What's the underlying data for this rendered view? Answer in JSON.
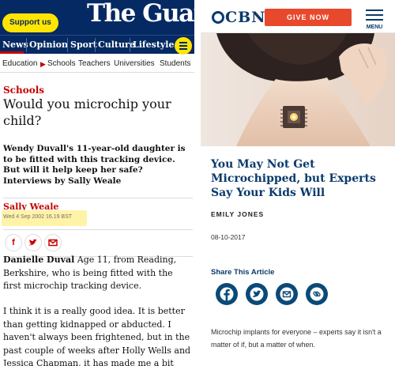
{
  "guardian": {
    "support_label": "Support us",
    "logo": "The Guardian",
    "nav": [
      "News",
      "Opinion",
      "Sport",
      "Culture",
      "Lifestyle"
    ],
    "subnav": [
      "Education",
      "Schools",
      "Teachers",
      "Universities",
      "Students"
    ],
    "section": "Schools",
    "headline": "Would you microchip your child?",
    "standfirst": "Wendy Duvall's 11-year-old daughter is to be fitted with this tracking device. But will it help keep her safe? Interviews by Sally Weale",
    "byline": "Sally Weale",
    "date": "Wed 4 Sep 2002 16.19 BST",
    "share_icons": [
      "facebook-icon",
      "twitter-icon",
      "email-icon"
    ],
    "body_name": "Danielle Duval",
    "body_p1": " Age 11, from Reading, Berkshire, who is being fitted with the first microchip tracking device.",
    "body_p2": "I think it is a really good idea. It is better than getting kidnapped or abducted. I haven't always been frightened, but in the past couple of weeks after Holly Wells and Jessica Chapman, it has made me a bit"
  },
  "cbn": {
    "logo": "CBN",
    "give_label": "GIVE NOW",
    "menu_label": "MENU",
    "title": "You May Not Get Microchipped, but Experts Say Your Kids Will",
    "author": "EMILY JONES",
    "date": "08-10-2017",
    "share_label": "Share This Article",
    "share_icons": [
      "facebook-icon",
      "twitter-icon",
      "email-icon",
      "link-icon"
    ],
    "body": "Microchip implants for everyone – experts say it isn't a matter of if, but a matter of when."
  },
  "colors": {
    "guardian_blue": "#052962",
    "guardian_red": "#c70000",
    "guardian_yellow": "#ffe500",
    "cbn_blue": "#0b3a6b",
    "cbn_orange": "#e8492c"
  }
}
